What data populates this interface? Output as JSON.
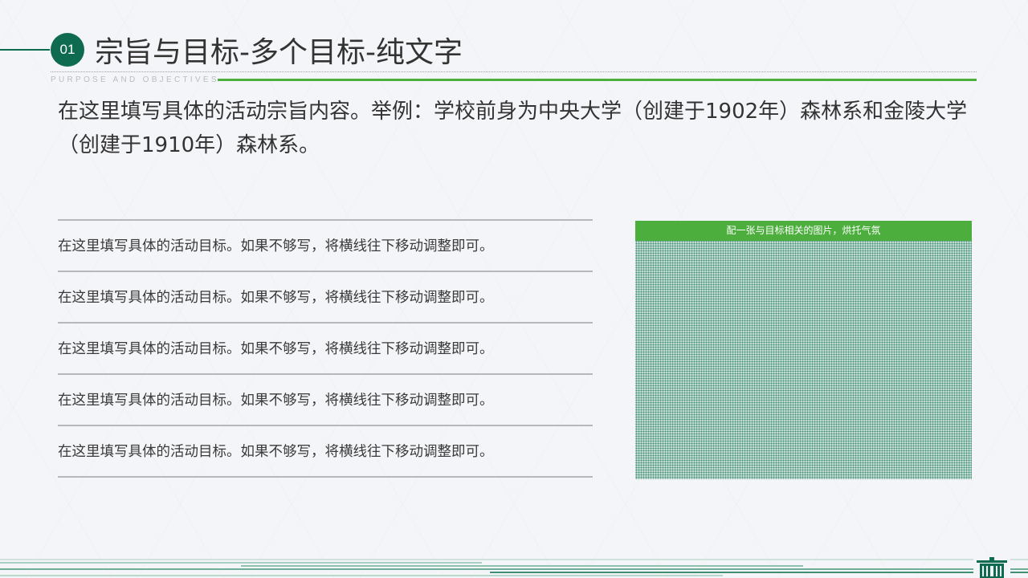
{
  "header": {
    "number": "01",
    "title": "宗旨与目标-多个目标-纯文字",
    "subtitle": "PURPOSE AND OBJECTIVES"
  },
  "intro": {
    "text": "在这里填写具体的活动宗旨内容。举例：学校前身为中央大学（创建于1902年）森林系和金陵大学（创建于1910年）森林系。"
  },
  "goals": [
    "在这里填写具体的活动目标。如果不够写，将横线往下移动调整即可。",
    "在这里填写具体的活动目标。如果不够写，将横线往下移动调整即可。",
    "在这里填写具体的活动目标。如果不够写，将横线往下移动调整即可。",
    "在这里填写具体的活动目标。如果不够写，将横线往下移动调整即可。",
    "在这里填写具体的活动目标。如果不够写，将横线往下移动调整即可。"
  ],
  "image_box": {
    "caption": "配一张与目标相关的图片，烘托气氛"
  },
  "colors": {
    "primary_green": "#0f6b4f",
    "accent_green": "#4cae3c",
    "text": "#333333"
  },
  "footer": {
    "logo_icon": "building-logo-icon"
  }
}
